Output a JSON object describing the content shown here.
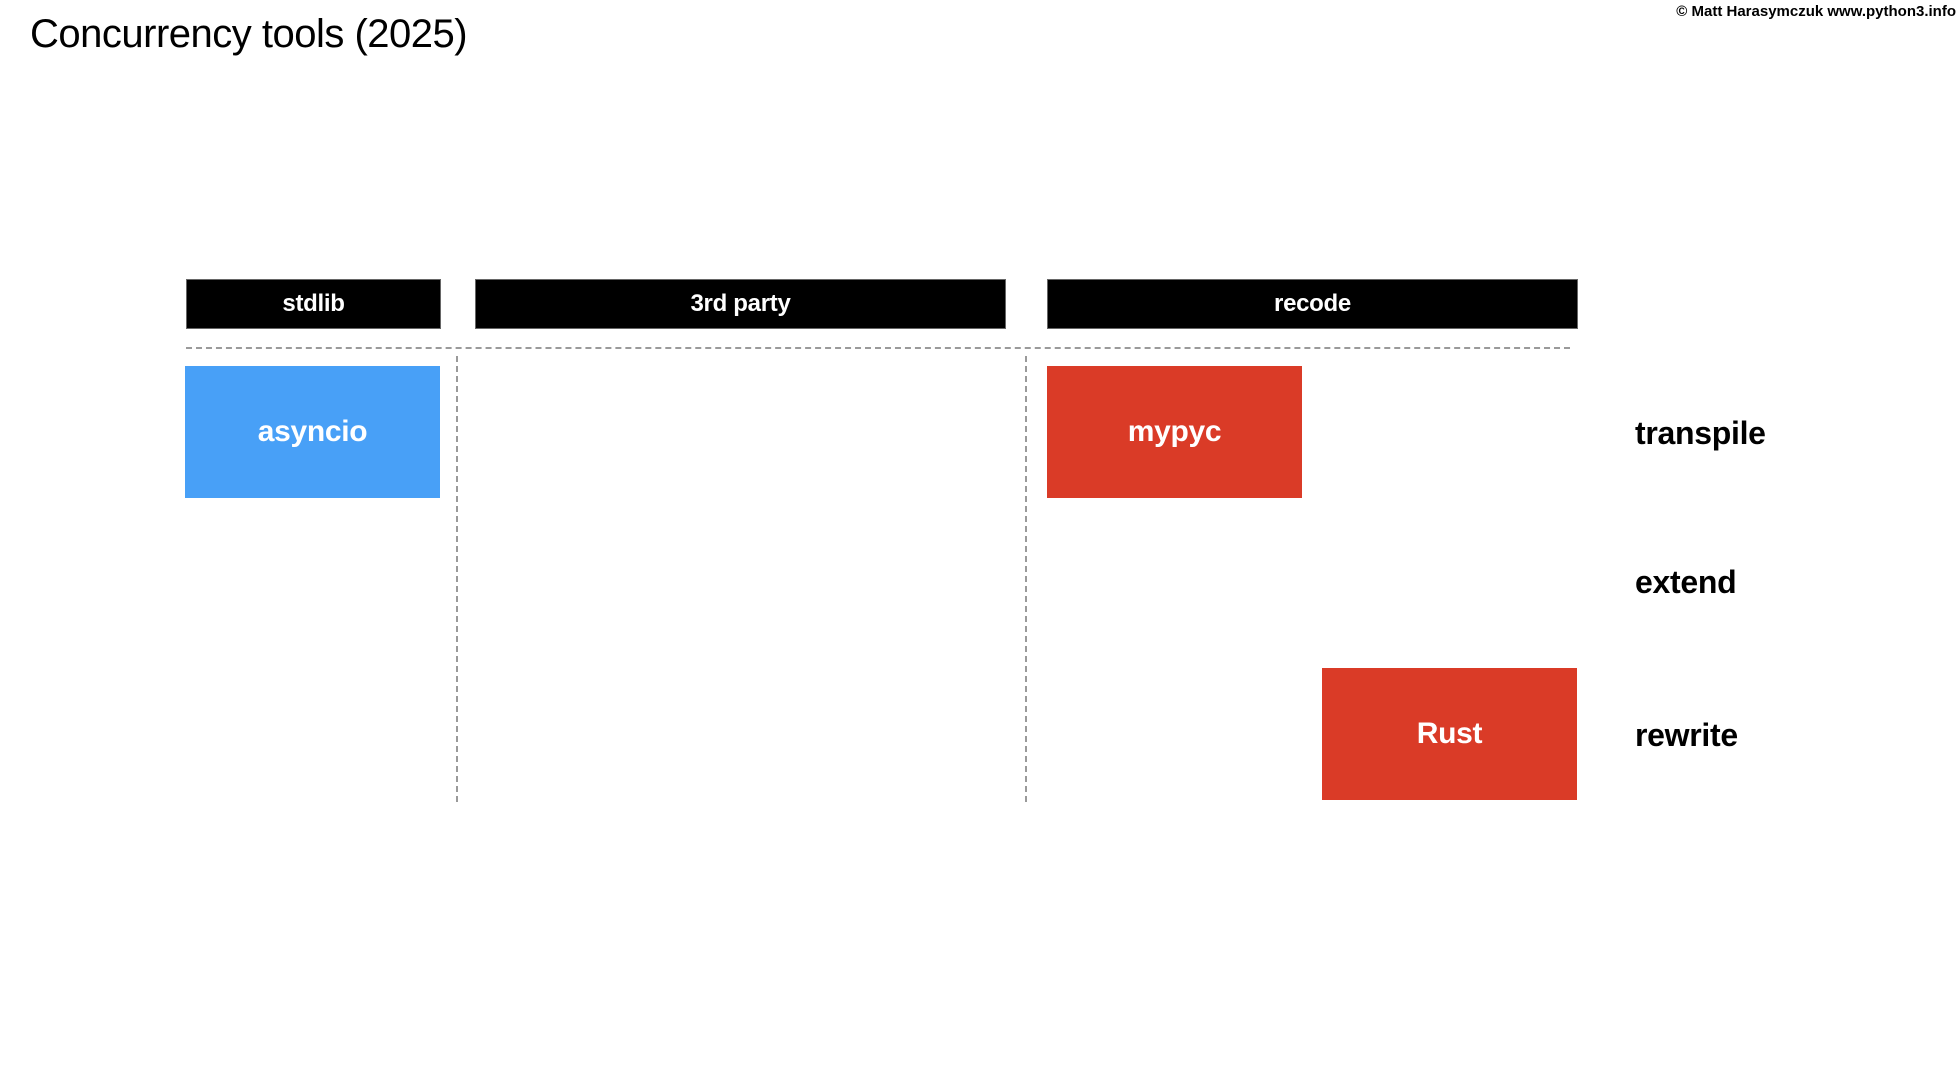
{
  "title": "Concurrency tools (2025)",
  "credit": "© Matt Harasymczuk www.python3.info",
  "colors": {
    "header_bg": "#000000",
    "stdlib_blue": "#48a0f7",
    "recode_red": "#da3b27",
    "divider_gray": "#9a9a9a"
  },
  "columns": [
    {
      "label": "stdlib"
    },
    {
      "label": "3rd party"
    },
    {
      "label": "recode"
    }
  ],
  "rows": [
    {
      "label": "transpile"
    },
    {
      "label": "extend"
    },
    {
      "label": "rewrite"
    }
  ],
  "tools": [
    {
      "label": "asyncio",
      "column": "stdlib",
      "row": "transpile",
      "color": "#48a0f7"
    },
    {
      "label": "mypyc",
      "column": "recode",
      "row": "transpile",
      "color": "#da3b27"
    },
    {
      "label": "Rust",
      "column": "recode",
      "row": "rewrite",
      "color": "#da3b27"
    }
  ]
}
